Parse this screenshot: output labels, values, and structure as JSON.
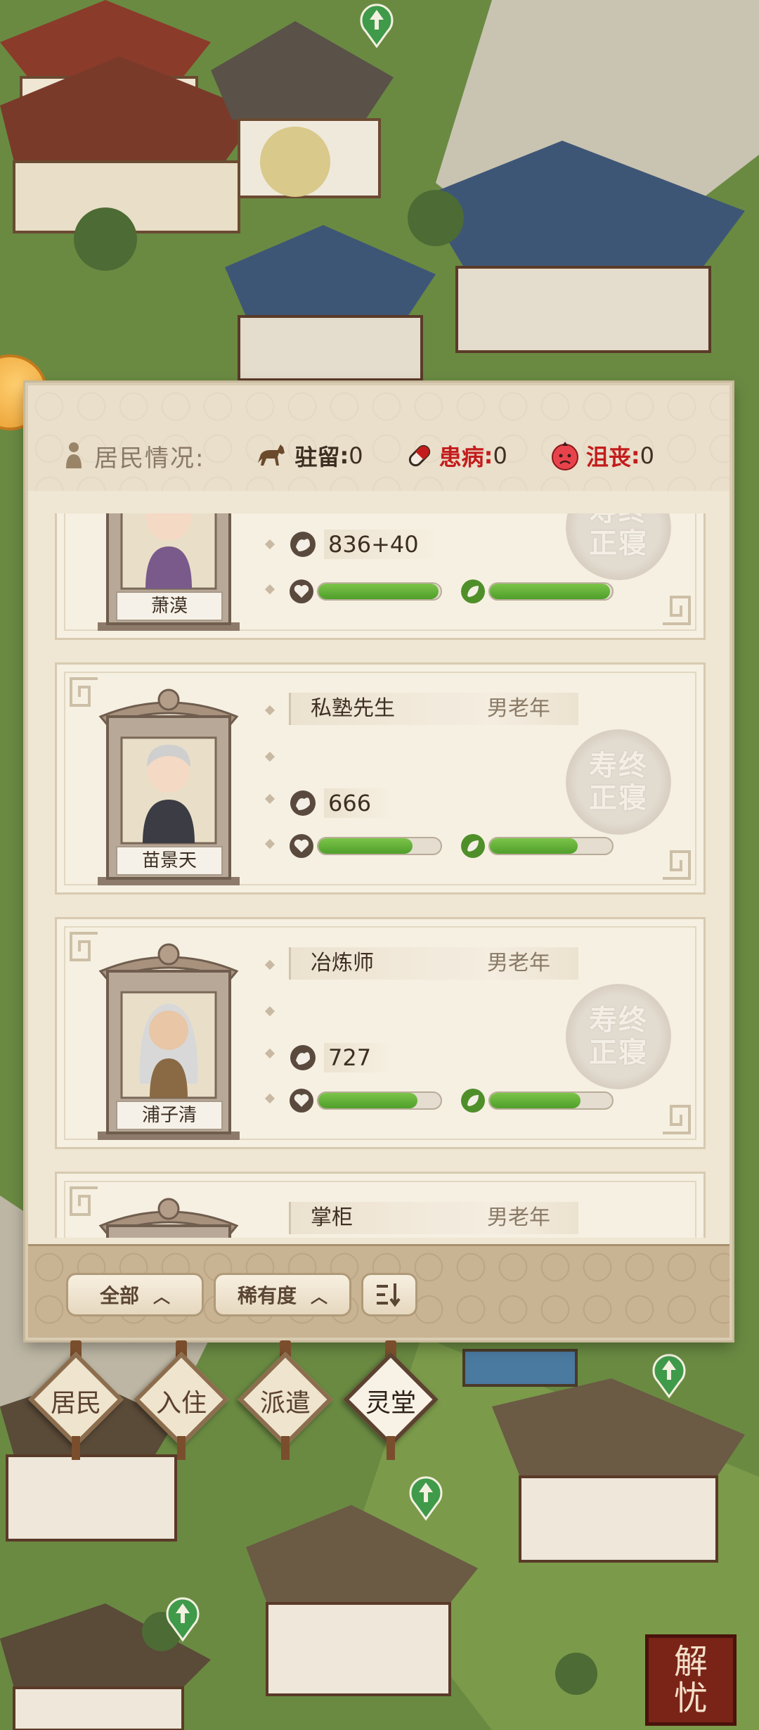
{
  "header": {
    "residents_label": "居民情况:",
    "stats": [
      {
        "name": "驻留",
        "sep": ":",
        "value": "0",
        "icon": "horse-icon"
      },
      {
        "name": "患病",
        "sep": ":",
        "value": "0",
        "icon": "pill-icon"
      },
      {
        "name": "沮丧",
        "sep": ":",
        "value": "0",
        "icon": "sad-face-icon"
      }
    ]
  },
  "residents": [
    {
      "name": "萧漠",
      "job": "",
      "gender": "",
      "power": "836+40",
      "health": 0.98,
      "mood": 0.98,
      "seal": "寿终正寝"
    },
    {
      "name": "苗景天",
      "job": "私塾先生",
      "gender": "男老年",
      "power": "666",
      "health": 0.77,
      "mood": 0.72,
      "seal": "寿终正寝"
    },
    {
      "name": "浦子清",
      "job": "冶炼师",
      "gender": "男老年",
      "power": "727",
      "health": 0.81,
      "mood": 0.74,
      "seal": "寿终正寝"
    },
    {
      "name": "",
      "job": "掌柜",
      "gender": "男老年",
      "power": "",
      "health": 0,
      "mood": 0,
      "seal": ""
    }
  ],
  "footer": {
    "filter_all": "全部",
    "filter_rarity": "稀有度",
    "sort_icon": "sort-icon"
  },
  "tabs": [
    {
      "label": "居民",
      "active": false
    },
    {
      "label": "入住",
      "active": false
    },
    {
      "label": "派遣",
      "active": false
    },
    {
      "label": "灵堂",
      "active": true
    }
  ],
  "relieve_button": {
    "line1": "解",
    "line2": "忧"
  },
  "colors": {
    "panel_bg": "#efe6d3",
    "bar_fill": "#5fb034",
    "alert_red": "#c41c1c",
    "grass": "#5f7f3c"
  }
}
